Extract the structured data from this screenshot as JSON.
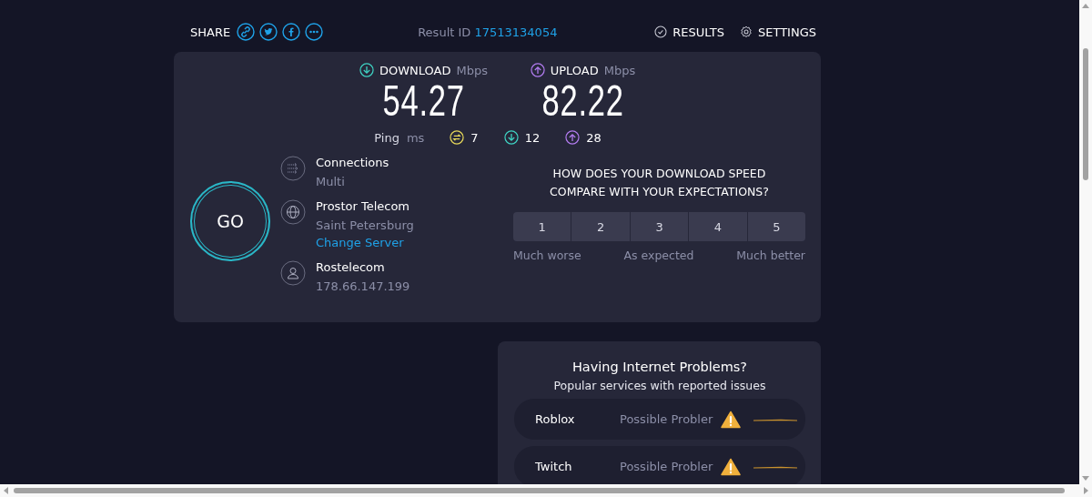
{
  "header": {
    "share_label": "SHARE",
    "share_icons": [
      {
        "kind": "link"
      },
      {
        "kind": "twitter"
      },
      {
        "kind": "facebook"
      },
      {
        "kind": "more"
      }
    ],
    "result_id_label": "Result ID",
    "result_id": "17513134054",
    "nav": [
      {
        "kind": "results",
        "label": "RESULTS"
      },
      {
        "kind": "settings",
        "label": "SETTINGS"
      }
    ]
  },
  "speeds": [
    {
      "kind": "download",
      "label": "DOWNLOAD",
      "unit": "Mbps",
      "value": "54.27"
    },
    {
      "kind": "upload",
      "label": "UPLOAD",
      "unit": "Mbps",
      "value": "82.22"
    }
  ],
  "ping": {
    "label": "Ping",
    "unit": "ms",
    "values": [
      {
        "kind": "idle",
        "value": "7"
      },
      {
        "kind": "download",
        "value": "12"
      },
      {
        "kind": "upload",
        "value": "28"
      }
    ]
  },
  "go_button": "GO",
  "info": [
    {
      "kind": "connections",
      "title": "Connections",
      "detail": "Multi"
    },
    {
      "kind": "server",
      "title": "Prostor Telecom",
      "detail": "Saint Petersburg",
      "link": "Change Server"
    },
    {
      "kind": "isp",
      "title": "Rostelecom",
      "detail": "178.66.147.199"
    }
  ],
  "survey": {
    "question": "HOW DOES YOUR DOWNLOAD SPEED COMPARE WITH YOUR EXPECTATIONS?",
    "options": [
      "1",
      "2",
      "3",
      "4",
      "5"
    ],
    "scale_labels": [
      "Much worse",
      "As expected",
      "Much better"
    ]
  },
  "problems": {
    "title": "Having Internet Problems?",
    "subtitle": "Popular services with reported issues",
    "services": [
      {
        "name": "Roblox",
        "status": "Possible Probler"
      },
      {
        "name": "Twitch",
        "status": "Possible Probler"
      }
    ]
  }
}
